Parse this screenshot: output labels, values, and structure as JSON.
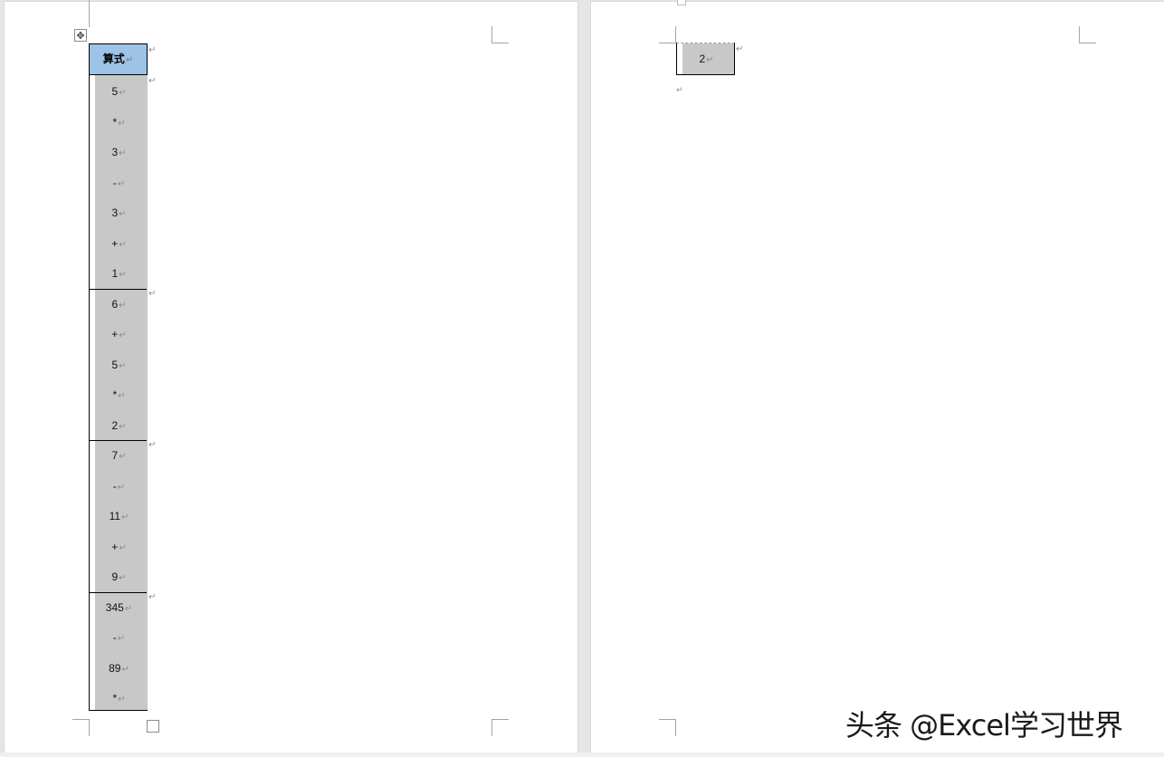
{
  "table": {
    "header": "算式",
    "groups": [
      [
        "5",
        "*",
        "3",
        "-",
        "3",
        "+",
        "1"
      ],
      [
        "6",
        "+",
        "5",
        "*",
        "2"
      ],
      [
        "7",
        "-",
        "11",
        "+",
        "9"
      ],
      [
        "345",
        "-",
        "89",
        "*"
      ]
    ]
  },
  "page2": {
    "cell_value": "2"
  },
  "marks": {
    "paragraph": "↵"
  },
  "icons": {
    "table_move": "move-icon",
    "table_resize": "resize-handle"
  },
  "watermark": "头条 @Excel学习世界",
  "colors": {
    "header_fill": "#9dc3e6",
    "cell_shading": "#c8c8c8"
  }
}
